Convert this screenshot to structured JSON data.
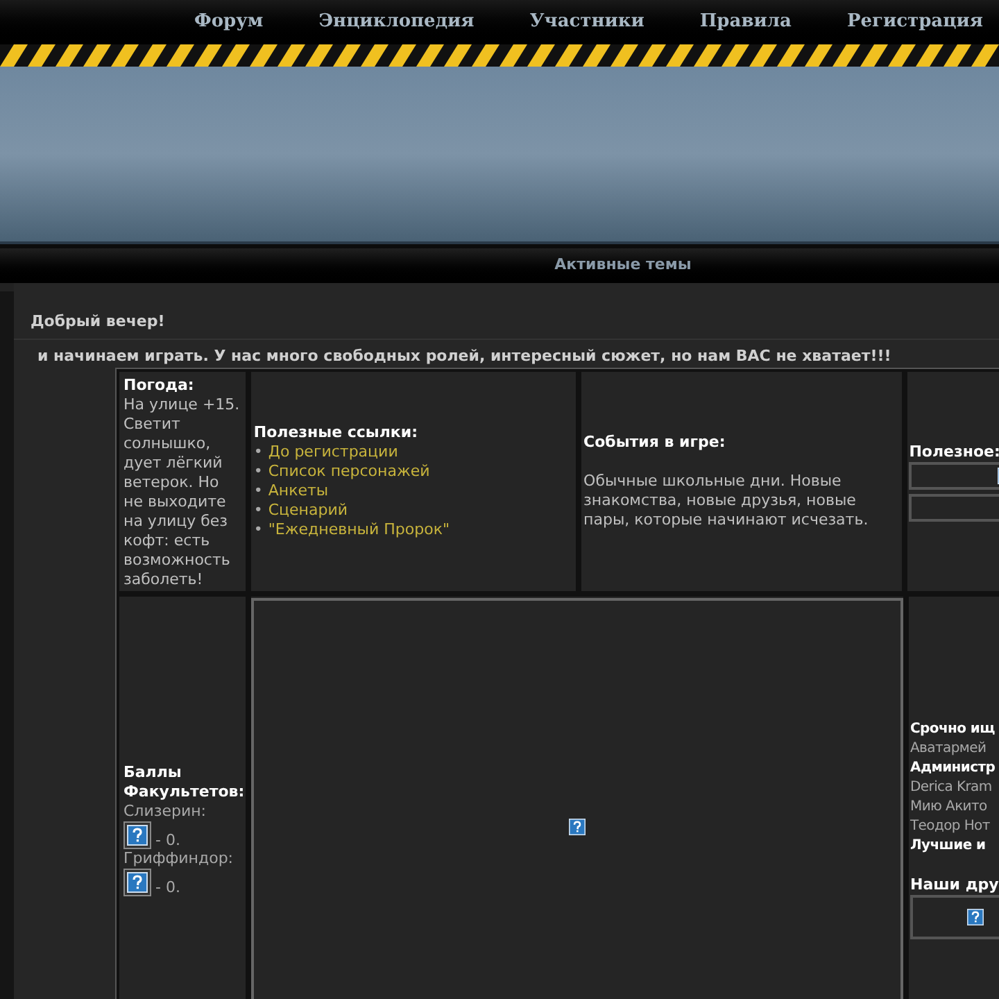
{
  "nav": {
    "items": [
      {
        "label": "Форум"
      },
      {
        "label": "Энциклопедия"
      },
      {
        "label": "Участники"
      },
      {
        "label": "Правила"
      },
      {
        "label": "Регистрация"
      }
    ]
  },
  "section_bar": {
    "title": "Активные темы"
  },
  "greeting": "Добрый вечер!",
  "announcement": "и начинаем играть. У нас много свободных ролей, интересный сюжет, но нам ВАС не хватает!!!",
  "weather": {
    "title": "Погода:",
    "text": "На улице +15. Светит солнышко, дует лёгкий ветерок. Но не выходите на улицу без кофт: есть возможность заболеть!"
  },
  "links": {
    "title": "Полезные ссылки:",
    "items": [
      {
        "bullet": "•",
        "label": "До регистрации"
      },
      {
        "bullet": "•",
        "label": "Список персонажей"
      },
      {
        "bullet": "•",
        "label": "Анкеты"
      },
      {
        "bullet": "•",
        "label": "Сценарий"
      },
      {
        "bullet": "•",
        "label": "\"Ежедневный Пророк\""
      }
    ]
  },
  "events": {
    "title": "События в игре:",
    "text": "Обычные школьные дни. Новые знакомства, новые друзья, новые пары, которые начинают исчезать."
  },
  "useful": {
    "title": "Полезное:"
  },
  "points": {
    "title": "Баллы Факультетов:",
    "houses": [
      {
        "name": "Слизерин:",
        "score": "- 0."
      },
      {
        "name": "Гриффиндор:",
        "score": "- 0."
      }
    ]
  },
  "sidebar": {
    "lines": [
      {
        "kind": "heading",
        "text": "Срочно ищ"
      },
      {
        "kind": "text",
        "text": "Аватармей"
      },
      {
        "kind": "heading",
        "text": "Администр"
      },
      {
        "kind": "text",
        "text": "Derica Kram"
      },
      {
        "kind": "text",
        "text": "Мию Акито"
      },
      {
        "kind": "text",
        "text": "Теодор Нот"
      },
      {
        "kind": "heading",
        "text": "Лучшие и"
      }
    ],
    "friends_title": "Наши дру"
  }
}
